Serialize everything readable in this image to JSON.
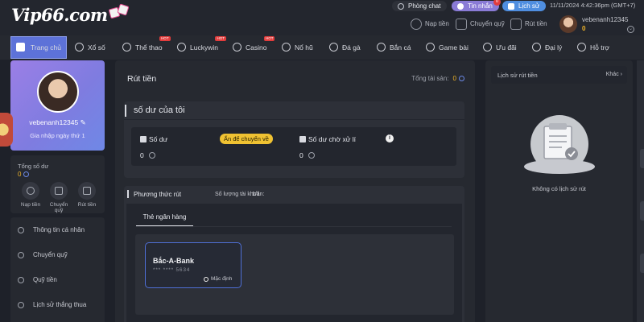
{
  "brand": {
    "logo_text": "Vip66.com"
  },
  "topbar": {
    "chat_label": "Phòng chat",
    "messages_label": "Tin nhắn",
    "messages_badge": "0",
    "history_label": "Lịch sử",
    "datetime": "11/11/2024 4:42:36pm  (GMT+7)",
    "quick_actions": [
      "Nạp tiền",
      "Chuyển quỹ",
      "Rút tiền"
    ],
    "username": "vebenanh12345",
    "balance": "0"
  },
  "nav": {
    "items": [
      {
        "label": "Trang chủ",
        "icon": "home-icon",
        "hot": ""
      },
      {
        "label": "Xổ số",
        "icon": "lottery-icon",
        "hot": ""
      },
      {
        "label": "Thể thao",
        "icon": "sports-icon",
        "hot": "HOT"
      },
      {
        "label": "Luckywin",
        "icon": "luckywin-icon",
        "hot": "HOT"
      },
      {
        "label": "Casino",
        "icon": "casino-icon",
        "hot": "HOT"
      },
      {
        "label": "Nổ hũ",
        "icon": "slots-icon",
        "hot": ""
      },
      {
        "label": "Đá gà",
        "icon": "cockfight-icon",
        "hot": ""
      },
      {
        "label": "Bắn cá",
        "icon": "fishing-icon",
        "hot": ""
      },
      {
        "label": "Game bài",
        "icon": "cards-icon",
        "hot": ""
      },
      {
        "label": "Ưu đãi",
        "icon": "gift-icon",
        "hot": ""
      },
      {
        "label": "Đại lý",
        "icon": "agent-icon",
        "hot": ""
      },
      {
        "label": "Hỗ trợ",
        "icon": "support-icon",
        "hot": ""
      }
    ]
  },
  "profile": {
    "username": "vebenanh12345",
    "login_days": "Gia nhập ngày thứ 1"
  },
  "sidebar": {
    "balance_label": "Tổng số dư",
    "balance_value": "0",
    "mini_actions": [
      "Nạp tiền",
      "Chuyển quỹ",
      "Rút tiền"
    ],
    "menu": [
      "Thông tin cá nhân",
      "Chuyển quỹ",
      "Quỹ tiền",
      "Lịch sử thắng thua"
    ]
  },
  "main": {
    "title": "Rút tiền",
    "total_assets_label": "Tổng tài sản:",
    "total_assets_value": "0",
    "my_balance_title": "số dư của tôi",
    "balance_label": "Số dư",
    "balance_value": "0",
    "hide_button": "Ấn để chuyển về",
    "pending_label": "Số dư chờ xử lí",
    "pending_value": "0",
    "method_label": "Phương thức rút",
    "accounts_label": "Số lượng tài khoản:",
    "accounts_value": "1/1",
    "bank_tab": "Thẻ ngân hàng",
    "bank_card": {
      "name": "Bắc-A-Bank",
      "number": "***  ****  5634",
      "default_label": "Mặc định"
    }
  },
  "history": {
    "title": "Lịch sử rút tiền",
    "filter": "Khác",
    "empty_text": "Không có lịch sử rút"
  },
  "colors": {
    "accent": "#5d72d8",
    "gold": "#f0b429",
    "profile_gradient_start": "#9b7fe6",
    "badge": "#e23c3c"
  }
}
